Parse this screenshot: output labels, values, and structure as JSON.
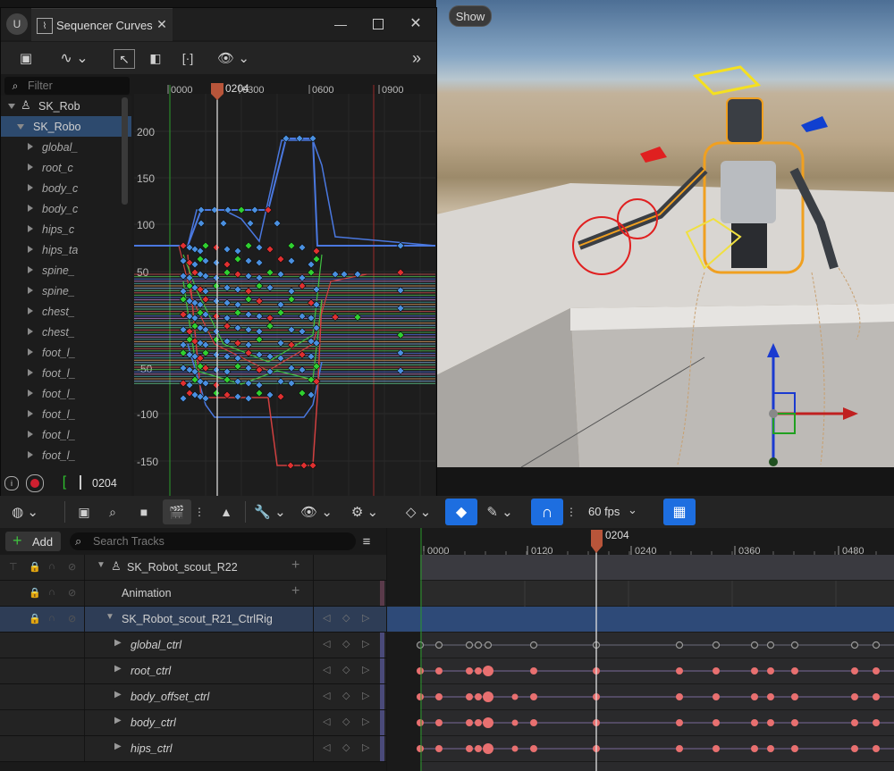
{
  "curve_editor": {
    "title": "Sequencer Curves",
    "filter_placeholder": "Filter",
    "current_frame": "0204",
    "bottom_frame": "0204",
    "ruler": [
      "0000",
      "0300",
      "0600",
      "0900"
    ],
    "y_ticks": [
      "200",
      "150",
      "100",
      "50",
      "-50",
      "-100",
      "-150"
    ],
    "tree": [
      {
        "label": "SK_Rob",
        "level": 0,
        "selected": false
      },
      {
        "label": "SK_Robo",
        "level": 1,
        "selected": true
      },
      {
        "label": "global_",
        "level": 2
      },
      {
        "label": "root_c",
        "level": 2
      },
      {
        "label": "body_c",
        "level": 2
      },
      {
        "label": "body_c",
        "level": 2
      },
      {
        "label": "hips_c",
        "level": 2
      },
      {
        "label": "hips_ta",
        "level": 2
      },
      {
        "label": "spine_",
        "level": 2
      },
      {
        "label": "spine_",
        "level": 2
      },
      {
        "label": "chest_",
        "level": 2
      },
      {
        "label": "chest_",
        "level": 2
      },
      {
        "label": "foot_l_",
        "level": 2
      },
      {
        "label": "foot_l_",
        "level": 2
      },
      {
        "label": "foot_l_",
        "level": 2
      },
      {
        "label": "foot_l_",
        "level": 2
      },
      {
        "label": "foot_l_",
        "level": 2
      },
      {
        "label": "foot_l_",
        "level": 2
      }
    ]
  },
  "viewport": {
    "show_label": "Show"
  },
  "sequencer": {
    "fps": "60 fps",
    "add_label": "Add",
    "search_placeholder": "Search Tracks",
    "current_frame": "0204",
    "ruler": [
      "0000",
      "0120",
      "0240",
      "0360",
      "0480"
    ],
    "tracks": [
      {
        "label": "SK_Robot_scout_R22",
        "type": "actor"
      },
      {
        "label": "Animation",
        "type": "sub"
      },
      {
        "label": "SK_Robot_scout_R21_CtrlRig",
        "type": "rig"
      },
      {
        "label": "global_ctrl",
        "type": "control"
      },
      {
        "label": "root_ctrl",
        "type": "control"
      },
      {
        "label": "body_offset_ctrl",
        "type": "control"
      },
      {
        "label": "body_ctrl",
        "type": "control"
      },
      {
        "label": "hips_ctrl",
        "type": "control"
      }
    ]
  }
}
